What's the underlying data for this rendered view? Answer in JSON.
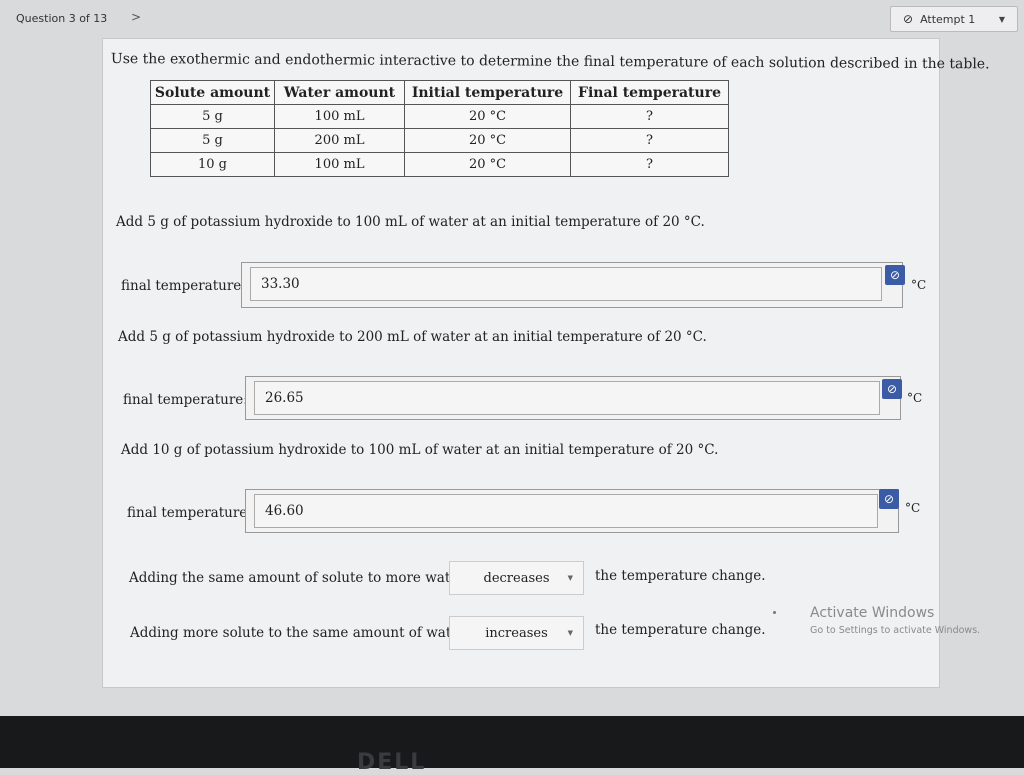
{
  "header": {
    "question_label": "Question 3 of 13",
    "next_glyph": ">",
    "attempt_label": "Attempt 1"
  },
  "intro": "Use the exothermic and endothermic interactive to determine the final temperature of each solution described in the table.",
  "table": {
    "headers": [
      "Solute amount",
      "Water amount",
      "Initial temperature",
      "Final temperature"
    ],
    "rows": [
      [
        "5 g",
        "100 mL",
        "20 °C",
        "?"
      ],
      [
        "5 g",
        "200 mL",
        "20 °C",
        "?"
      ],
      [
        "10 g",
        "100 mL",
        "20 °C",
        "?"
      ]
    ]
  },
  "questions": [
    {
      "prompt": "Add 5 g of potassium hydroxide to 100 mL of water at an initial temperature of 20 °C.",
      "label": "final temperature:",
      "value": "33.30",
      "unit": "°C"
    },
    {
      "prompt": "Add 5 g of potassium hydroxide to 200 mL of water at an initial temperature of 20 °C.",
      "label": "final temperature:",
      "value": "26.65",
      "unit": "°C"
    },
    {
      "prompt": "Add 10 g of potassium hydroxide to 100 mL of water at an initial temperature of 20 °C.",
      "label": "final temperature:",
      "value": "46.60",
      "unit": "°C"
    }
  ],
  "statements": [
    {
      "before": "Adding the same amount of solute to more water",
      "selected": "decreases",
      "after": "the temperature change."
    },
    {
      "before": "Adding more solute to the same amount of water",
      "selected": "increases",
      "after": "the temperature change."
    }
  ],
  "watermark": {
    "title": "Activate Windows",
    "subtitle": "Go to Settings to activate Windows."
  },
  "monitor_brand": "DELL",
  "colors": {
    "badge": "#3b5ba6",
    "card": "#f0f1f2",
    "bezel": "#18191b"
  },
  "icons": {
    "attempt": "circle-slash-icon",
    "badge": "circle-slash-icon",
    "caret": "caret-down-icon"
  }
}
